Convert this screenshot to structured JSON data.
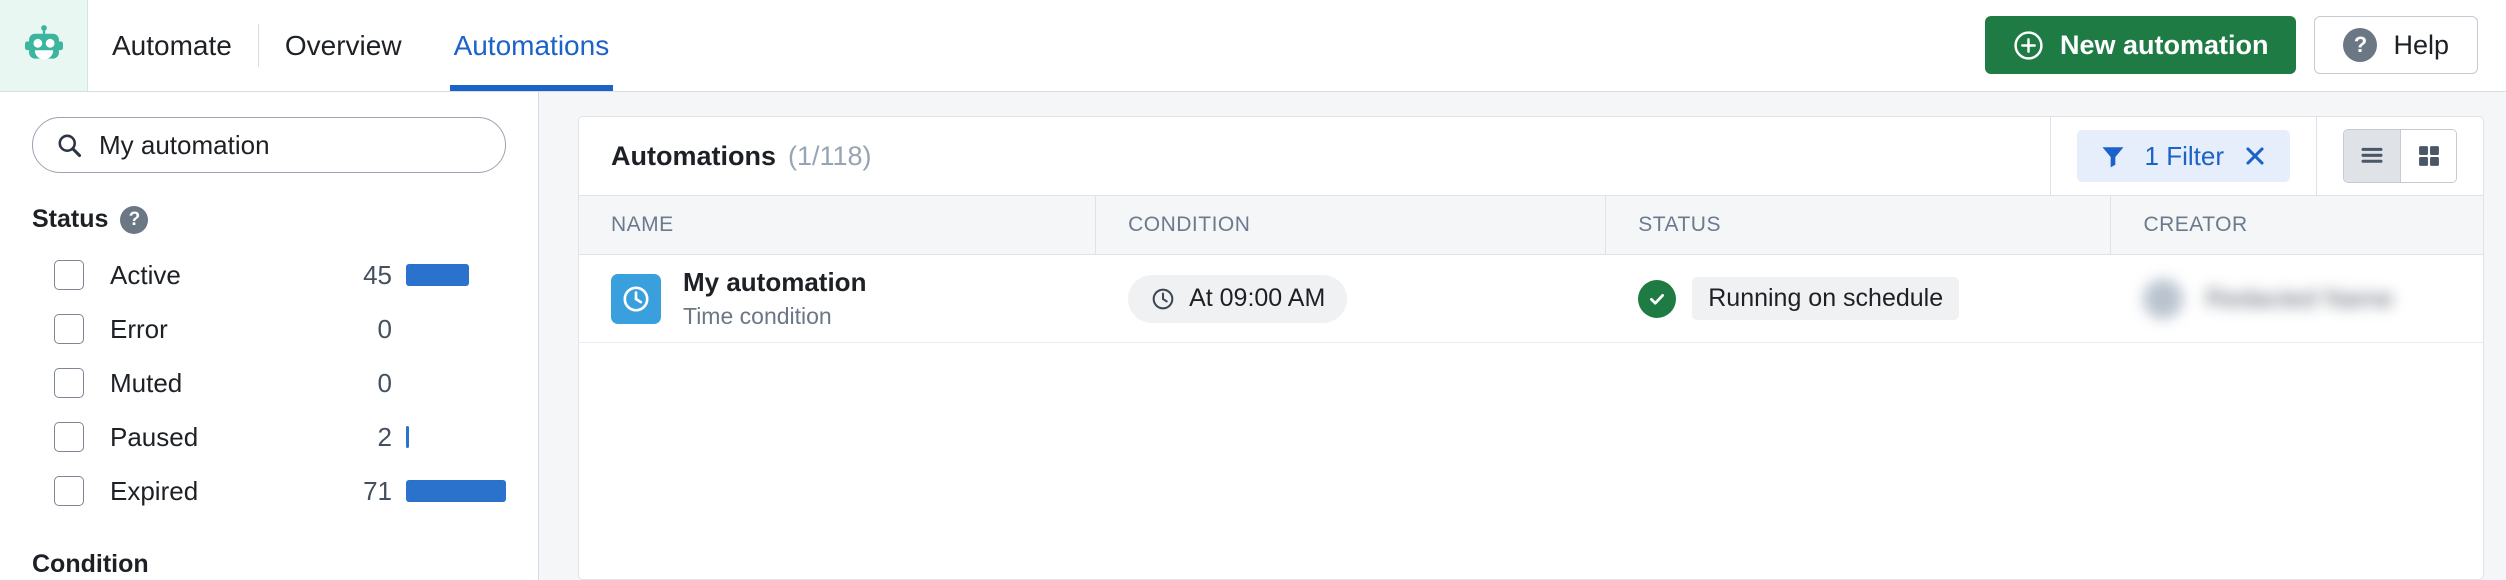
{
  "topbar": {
    "logo_icon": "robot-icon",
    "app_name": "Automate",
    "tabs": [
      {
        "label": "Overview",
        "active": false
      },
      {
        "label": "Automations",
        "active": true
      }
    ],
    "new_automation_label": "New automation",
    "new_automation_icon": "plus-circle-icon",
    "help_label": "Help",
    "help_icon": "question-circle-icon",
    "accent_blue": "#1b62c9",
    "green": "#1e7b44",
    "logo_bg": "#e9f7f2",
    "logo_color": "#3cb59e"
  },
  "sidebar": {
    "search": {
      "icon": "search-icon",
      "value": "My automation",
      "placeholder": "Search"
    },
    "status_section": {
      "title": "Status",
      "help_icon": "question-circle-icon",
      "items": [
        {
          "label": "Active",
          "count": "45",
          "bar_pct": 63,
          "checked": false
        },
        {
          "label": "Error",
          "count": "0",
          "bar_pct": 0,
          "checked": false
        },
        {
          "label": "Muted",
          "count": "0",
          "bar_pct": 0,
          "checked": false
        },
        {
          "label": "Paused",
          "count": "2",
          "bar_pct": 3,
          "checked": false
        },
        {
          "label": "Expired",
          "count": "71",
          "bar_pct": 100,
          "checked": false
        }
      ]
    },
    "condition_section": {
      "title": "Condition"
    },
    "bar_color": "#2a72cb"
  },
  "main": {
    "card_title": "Automations",
    "card_count": "(1/118)",
    "filter_chip": {
      "icon": "filter-funnel-icon",
      "label": "1 Filter",
      "clear_icon": "close-x-icon"
    },
    "view_toggle": {
      "list_icon": "list-view-icon",
      "grid_icon": "grid-view-icon",
      "selected": "list"
    },
    "table": {
      "columns": [
        "NAME",
        "CONDITION",
        "STATUS",
        "CREATOR"
      ],
      "rows": [
        {
          "icon": "clock-icon",
          "name": "My automation",
          "subtitle": "Time condition",
          "condition_icon": "clock-icon",
          "condition": "At 09:00 AM",
          "status_icon": "check-circle-icon",
          "status": "Running on schedule",
          "creator_avatar": "avatar",
          "creator": "Redacted Name"
        }
      ]
    }
  }
}
